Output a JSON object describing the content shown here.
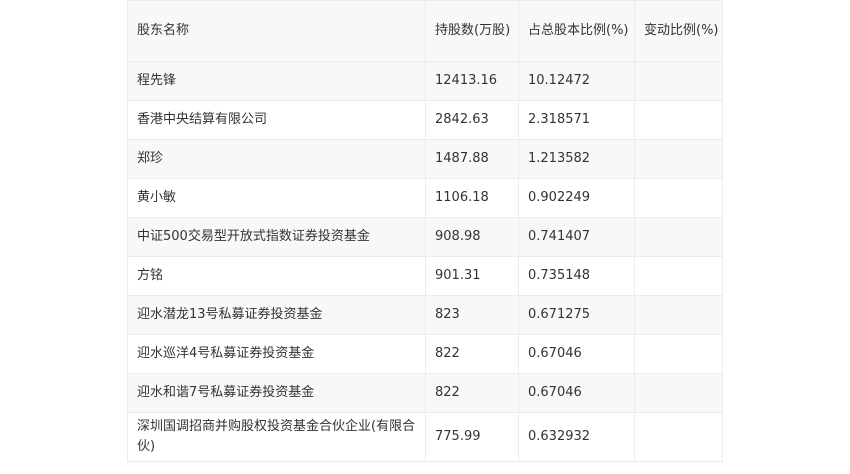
{
  "table": {
    "headers": [
      "股东名称",
      "持股数(万股)",
      "占总股本比例(%)",
      "变动比例(%)"
    ],
    "rows": [
      {
        "name": "程先锋",
        "shares": "12413.16",
        "ratio": "10.12472",
        "change": ""
      },
      {
        "name": "香港中央结算有限公司",
        "shares": "2842.63",
        "ratio": "2.318571",
        "change": ""
      },
      {
        "name": "郑珍",
        "shares": "1487.88",
        "ratio": "1.213582",
        "change": ""
      },
      {
        "name": "黄小敏",
        "shares": "1106.18",
        "ratio": "0.902249",
        "change": ""
      },
      {
        "name": "中证500交易型开放式指数证券投资基金",
        "shares": "908.98",
        "ratio": "0.741407",
        "change": ""
      },
      {
        "name": "方铭",
        "shares": "901.31",
        "ratio": "0.735148",
        "change": ""
      },
      {
        "name": "迎水潜龙13号私募证券投资基金",
        "shares": "823",
        "ratio": "0.671275",
        "change": ""
      },
      {
        "name": "迎水巡洋4号私募证券投资基金",
        "shares": "822",
        "ratio": "0.67046",
        "change": ""
      },
      {
        "name": "迎水和谐7号私募证券投资基金",
        "shares": "822",
        "ratio": "0.67046",
        "change": ""
      },
      {
        "name": "深圳国调招商并购股权投资基金合伙企业(有限合伙)",
        "shares": "775.99",
        "ratio": "0.632932",
        "change": ""
      }
    ]
  }
}
